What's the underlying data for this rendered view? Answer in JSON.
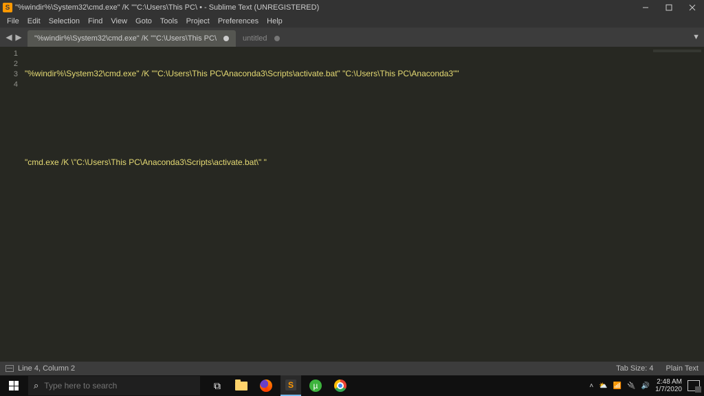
{
  "titlebar": {
    "icon_text": "S",
    "title": "\"%windir%\\System32\\cmd.exe\" /K \"\"C:\\Users\\This PC\\ • - Sublime Text (UNREGISTERED)"
  },
  "menubar": [
    "File",
    "Edit",
    "Selection",
    "Find",
    "View",
    "Goto",
    "Tools",
    "Project",
    "Preferences",
    "Help"
  ],
  "tabs": [
    {
      "label": "\"%windir%\\System32\\cmd.exe\" /K \"\"C:\\Users\\This PC\\",
      "active": true,
      "dirty": true
    },
    {
      "label": "untitled",
      "active": false,
      "dirty": true
    }
  ],
  "tab_dropdown": "▼",
  "editor": {
    "line_numbers": [
      "1",
      "2",
      "3",
      "4"
    ],
    "lines": [
      "\"%windir%\\System32\\cmd.exe\" /K \"\"C:\\Users\\This PC\\Anaconda3\\Scripts\\activate.bat\" \"C:\\Users\\This PC\\Anaconda3\"\"",
      "",
      "",
      "\"cmd.exe /K \\\"C:\\Users\\This PC\\Anaconda3\\Scripts\\activate.bat\\\" \""
    ]
  },
  "statusbar": {
    "position": "Line 4, Column 2",
    "tab_size": "Tab Size: 4",
    "syntax": "Plain Text"
  },
  "taskbar": {
    "search_placeholder": "Type here to search",
    "tray": {
      "arrow": "˄",
      "cloud": "⛅",
      "wifi": "📶",
      "power": "🔌",
      "volume": "🔊",
      "time": "2:48 AM",
      "date": "1/7/2020",
      "notification_count": "2"
    }
  }
}
